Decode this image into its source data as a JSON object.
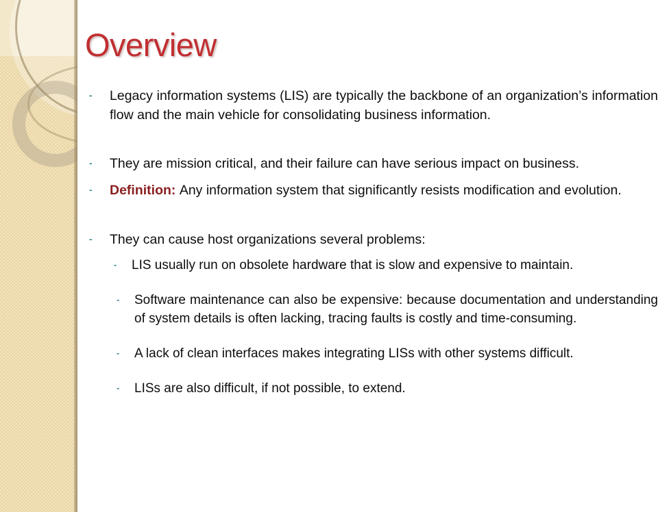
{
  "slide": {
    "title": "Overview",
    "title_color": "#c12f32",
    "bullet_marker": "-",
    "bullet_marker_color": "#3b8b8e",
    "definition_label": "Definition:",
    "definition_color": "#8b2020",
    "background_color": "#ffffff",
    "sidebar_color": "#f3e4bd",
    "bullets": [
      {
        "level": 1,
        "text": "Legacy information systems (LIS) are typically the backbone of an organization’s information flow and the main vehicle for consolidating business information."
      },
      {
        "level": 1,
        "text": "They are mission critical, and their failure can have serious impact on business."
      },
      {
        "level": 1,
        "label": "Definition:",
        "text": "Any information system that significantly resists modification and evolution."
      },
      {
        "level": 1,
        "text": "They can cause host organizations several problems:"
      },
      {
        "level": 2,
        "text": "LIS usually run on obsolete hardware that is slow and expensive to maintain."
      },
      {
        "level": 2,
        "text": "Software maintenance  can also be expensive: because documentation and understanding of system details is often lacking, tracing faults is costly and time-consuming."
      },
      {
        "level": 2,
        "text": "A lack of clean interfaces makes integrating LISs with other systems difficult."
      },
      {
        "level": 2,
        "text": "LISs are also difficult, if not possible, to extend."
      }
    ]
  }
}
